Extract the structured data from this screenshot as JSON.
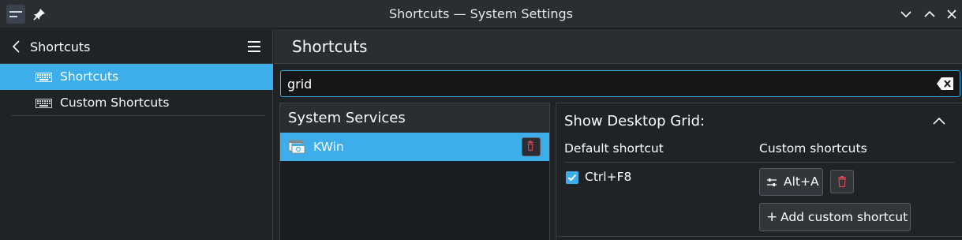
{
  "window": {
    "title": "Shortcuts — System Settings"
  },
  "sidebar": {
    "back_label": "Shortcuts",
    "items": [
      {
        "label": "Shortcuts",
        "icon": "keyboard-icon",
        "active": true
      },
      {
        "label": "Custom Shortcuts",
        "icon": "keyboard-icon",
        "active": false
      }
    ]
  },
  "main": {
    "title": "Shortcuts",
    "search": {
      "value": "grid",
      "placeholder": ""
    }
  },
  "services": {
    "header": "System Services",
    "items": [
      {
        "label": "KWin",
        "icon": "kwin-icon",
        "selected": true
      }
    ]
  },
  "detail": {
    "title": "Show Desktop Grid:",
    "default_header": "Default shortcut",
    "custom_header": "Custom shortcuts",
    "default_shortcut": "Ctrl+F8",
    "default_checked": true,
    "custom_shortcut": "Alt+A",
    "add_label": "Add custom shortcut"
  },
  "colors": {
    "accent": "#3daee9",
    "background": "#202326",
    "header": "#2a2e32",
    "delete": "#da4453"
  }
}
